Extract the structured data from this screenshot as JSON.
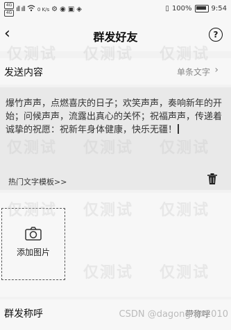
{
  "status": {
    "sim1": "4G",
    "sim2": "4G",
    "signal": "ıll ıll",
    "speed": "0 K/s",
    "battery_pct": "100%",
    "time": "9:54"
  },
  "nav": {
    "back": "‹",
    "title": "群发好友",
    "help": "?"
  },
  "content_header": {
    "label": "发送内容",
    "mode": "单条文字",
    "chevron": "›"
  },
  "message": {
    "text": "爆竹声声，点燃喜庆的日子；欢笑声声，奏响新年的开始；问候声声，流露出真心的关怀；祝福声声，传递着诚挚的祝愿：祝新年身体健康，快乐无疆！",
    "template_link": "热门文字模板>>"
  },
  "image": {
    "add_label": "添加图片"
  },
  "bottom": {
    "label": "群发称呼",
    "value": "带称呼"
  },
  "watermark": "仅测试",
  "credit": "CSDN @dagongren2010"
}
